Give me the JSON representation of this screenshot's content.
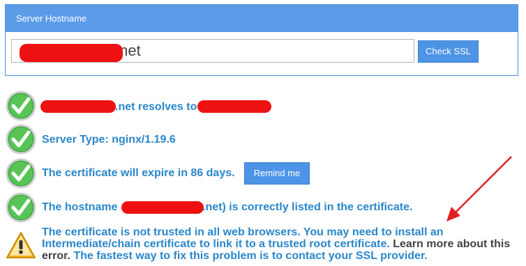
{
  "header": {
    "title": "Server Hostname"
  },
  "form": {
    "hostname_value": ".net",
    "check_button": "Check SSL"
  },
  "results": {
    "resolves": ".net resolves to",
    "server_type": "Server Type: nginx/1.19.6",
    "expiry": "The certificate will expire in 86 days.",
    "remind_button": "Remind me",
    "hostname_prefix": "The hostname",
    "hostname_suffix": ".net) is correctly listed in the certificate.",
    "warning_part1": "The certificate is not trusted in all web browsers. You may need to install an Intermediate/chain certificate to link it to a trusted root certificate.",
    "warning_link": " Learn more about this error.",
    "warning_part2": " The fastest way to fix this problem is to contact your SSL provider."
  },
  "icons": {
    "ok": "check-circle-icon",
    "warn": "warning-triangle-icon"
  },
  "colors": {
    "accent": "#5b9ce9",
    "text_blue": "#2b87c9",
    "redaction": "#ee1111",
    "arrow": "#e02020"
  }
}
